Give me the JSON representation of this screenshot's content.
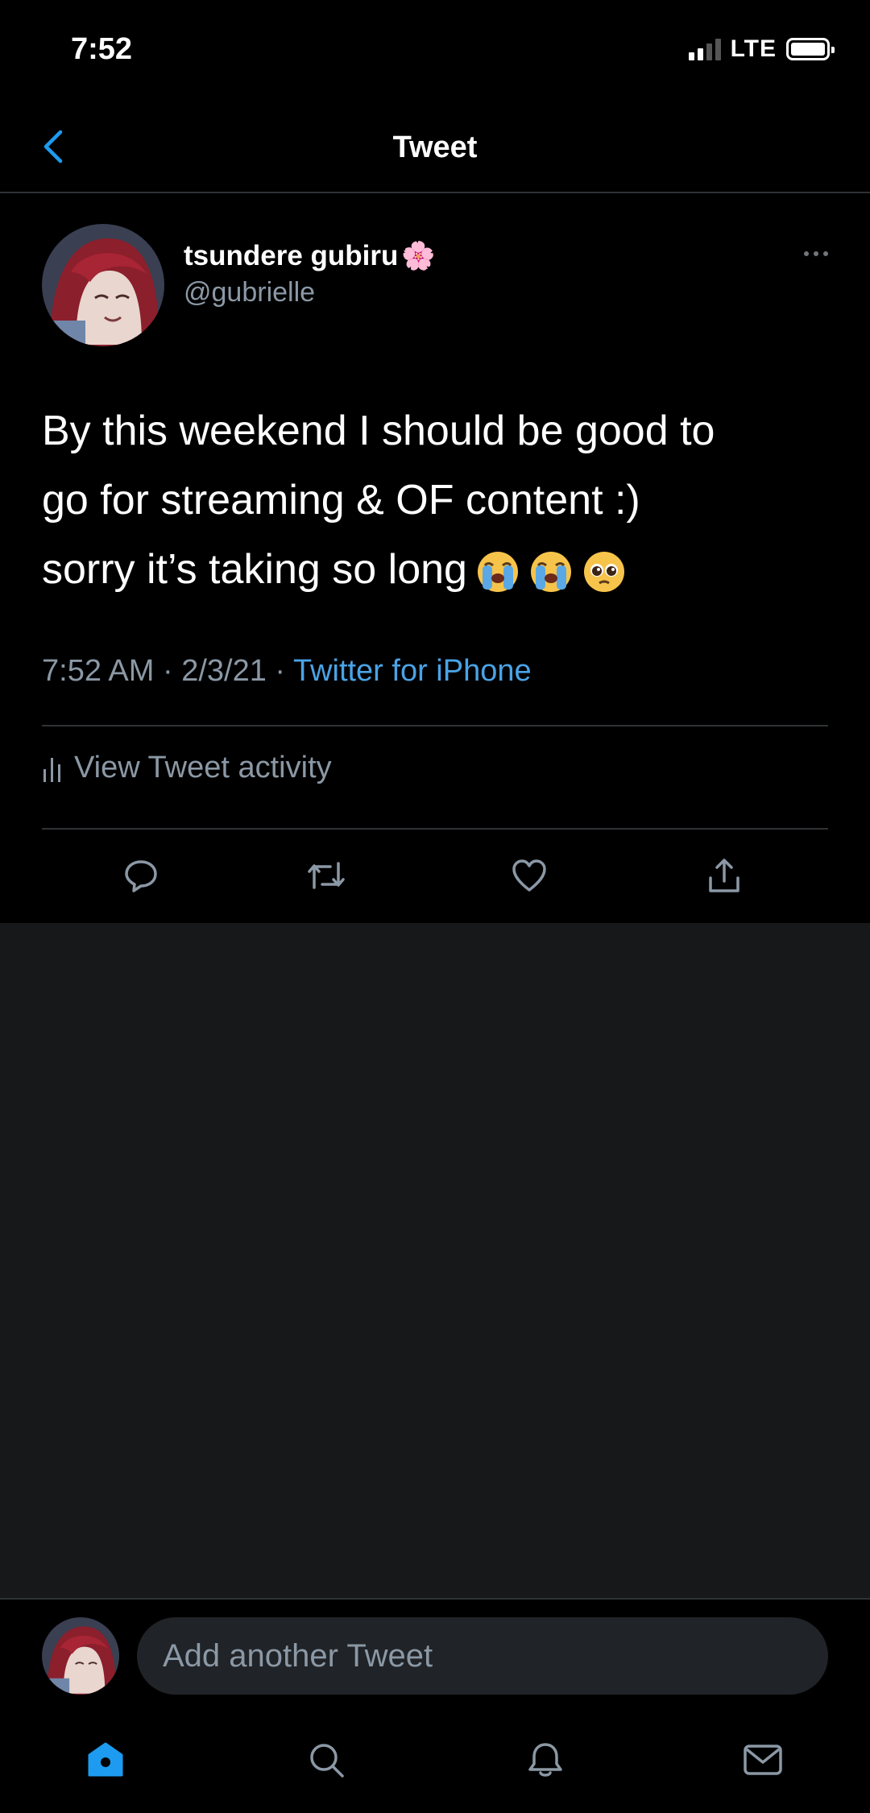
{
  "status_bar": {
    "time": "7:52",
    "network": "LTE"
  },
  "header": {
    "title": "Tweet"
  },
  "tweet": {
    "display_name": "tsundere gubiru",
    "display_emoji": "🌸",
    "handle": "@gubrielle",
    "text_line1": "By this weekend I should be good to",
    "text_line2": "go for streaming & OF content :)",
    "text_line3": "sorry it’s taking so long",
    "timestamp": "7:52 AM · 2/3/21 · ",
    "source": "Twitter for iPhone",
    "activity_label": "View Tweet activity"
  },
  "reply_bar": {
    "placeholder": "Add another Tweet"
  },
  "colors": {
    "accent": "#1d9bf0",
    "muted": "#8b98a5",
    "background": "#000000",
    "empty_area": "#16181a"
  },
  "icons": [
    "back-icon",
    "more-icon",
    "reply-icon",
    "retweet-icon",
    "like-icon",
    "share-icon",
    "home-icon",
    "search-icon",
    "notifications-icon",
    "messages-icon"
  ]
}
